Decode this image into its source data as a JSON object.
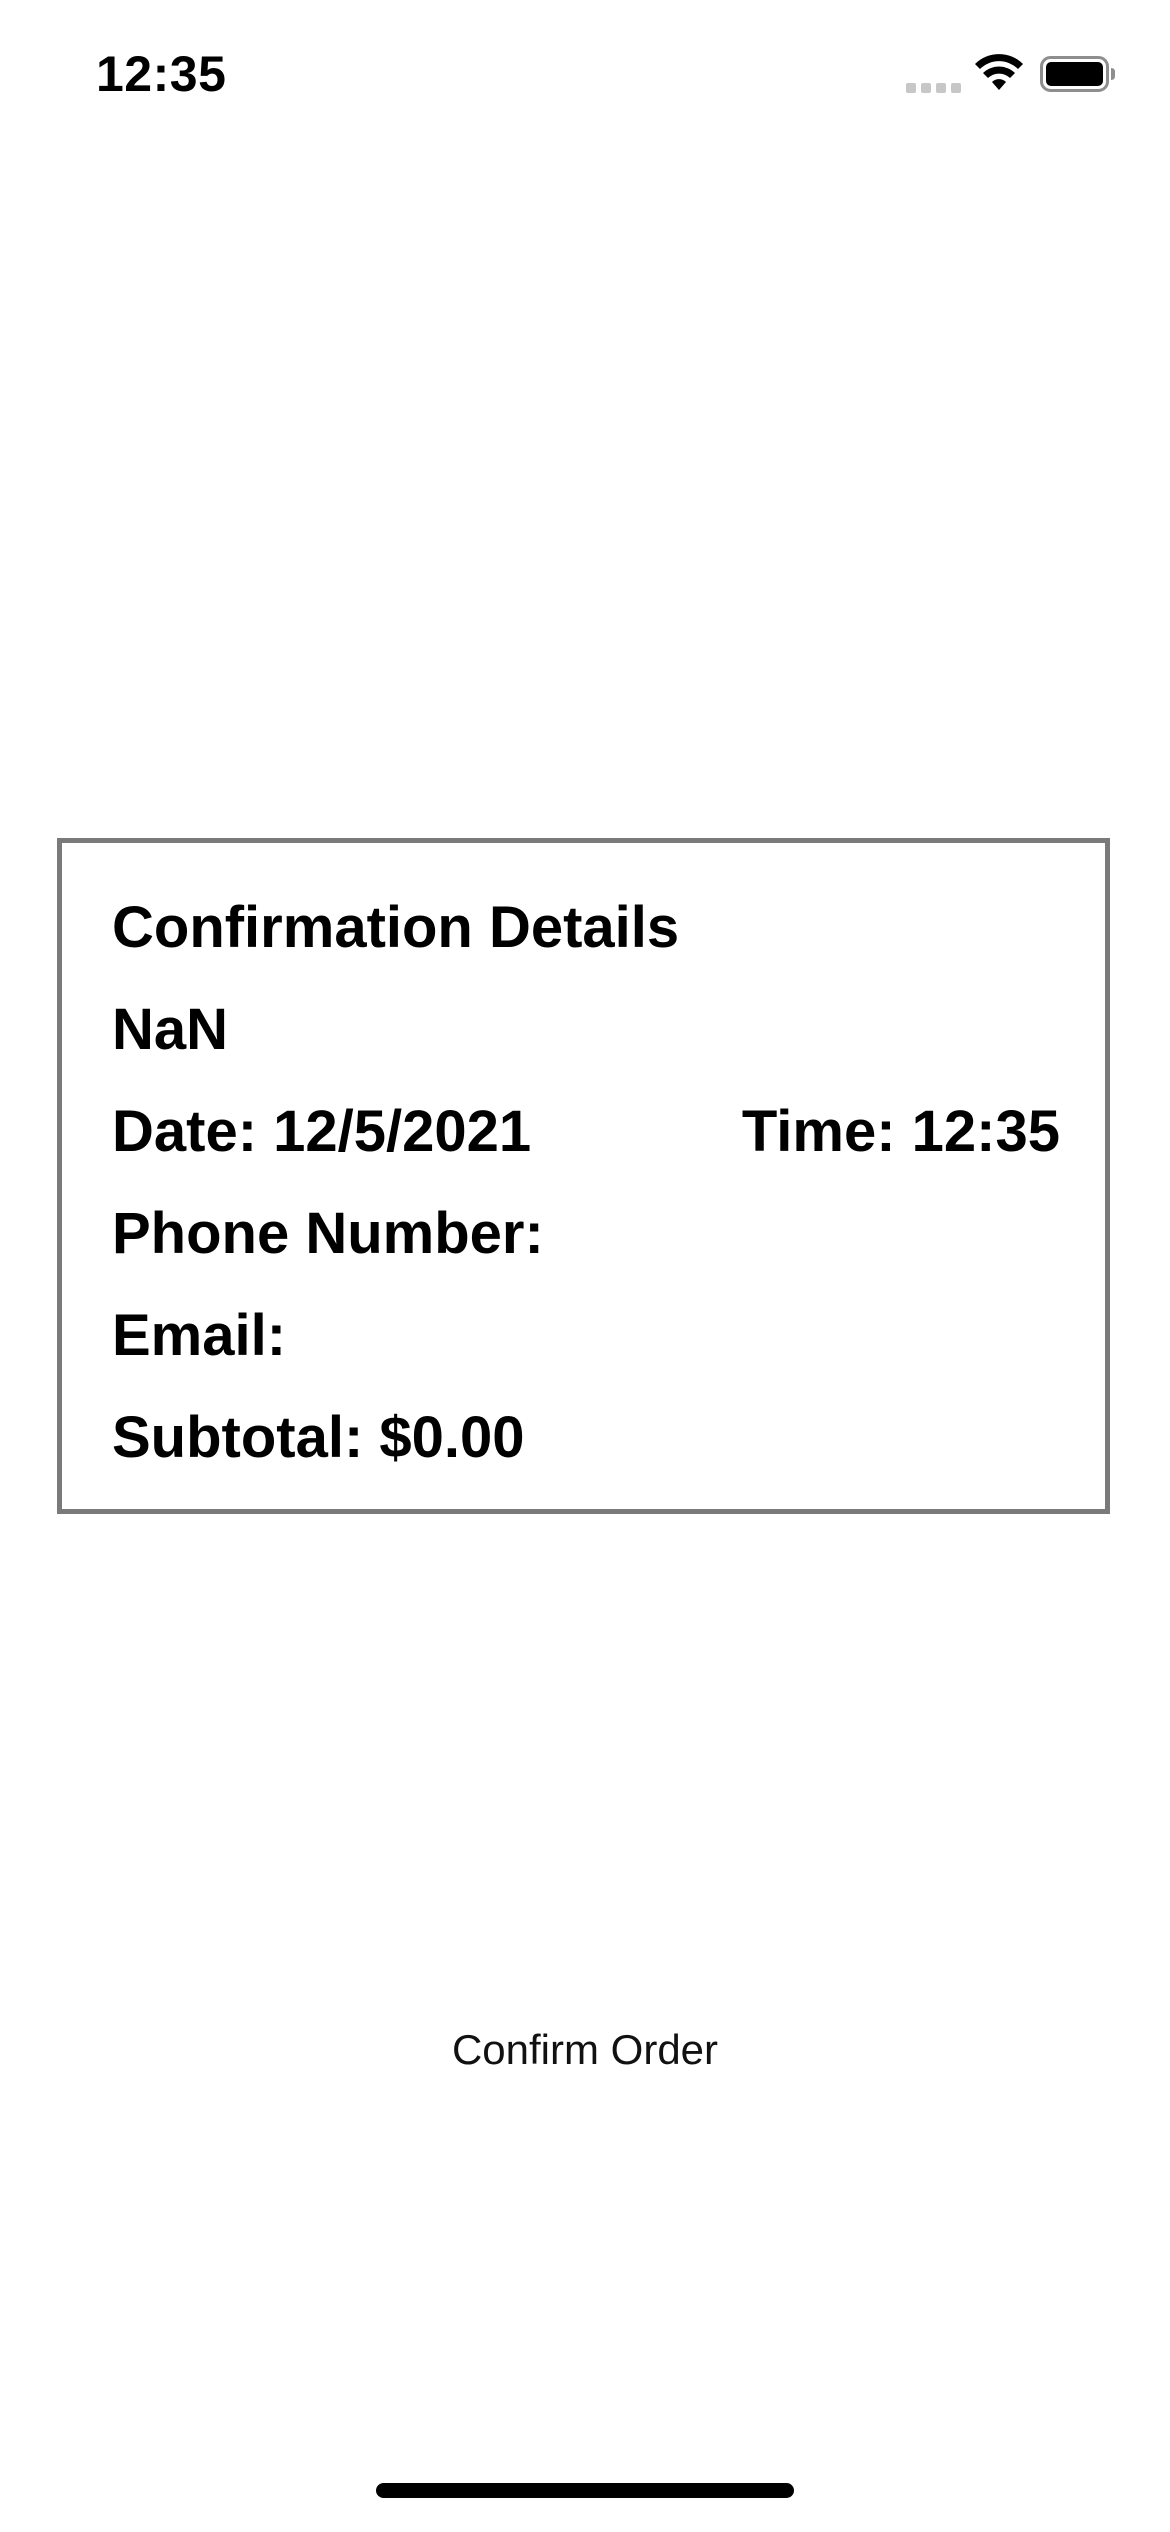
{
  "status_bar": {
    "time": "12:35",
    "icons": [
      "cellular-signal-icon",
      "wifi-icon",
      "battery-icon"
    ]
  },
  "confirmation": {
    "title": "Confirmation Details",
    "name": "NaN",
    "date": "Date: 12/5/2021",
    "time": "Time: 12:35",
    "phone": "Phone Number:",
    "email": "Email:",
    "subtotal": "Subtotal: $0.00"
  },
  "actions": {
    "confirm_label": "Confirm Order"
  },
  "colors": {
    "card_border": "#7a7a7a",
    "text": "#000000",
    "background": "#ffffff"
  }
}
